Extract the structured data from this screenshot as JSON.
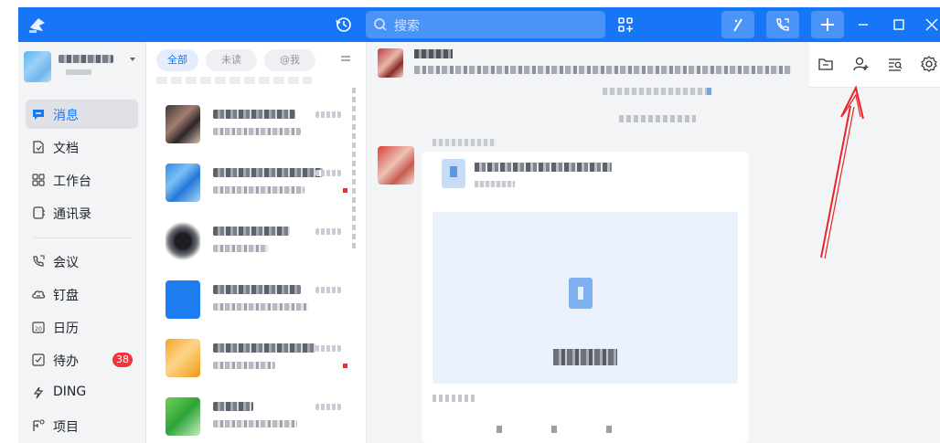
{
  "titlebar": {
    "search_placeholder": "搜索",
    "accent_color": "#1676f5",
    "icons": [
      "logo-icon",
      "history-icon",
      "search-icon",
      "apps-icon",
      "slash-app-icon",
      "phone-icon",
      "plus-icon",
      "minimize-icon",
      "maximize-icon",
      "close-icon"
    ]
  },
  "nav": {
    "items": [
      {
        "label": "消息",
        "icon": "message-icon",
        "active": true
      },
      {
        "label": "文档",
        "icon": "document-icon"
      },
      {
        "label": "工作台",
        "icon": "workbench-icon"
      },
      {
        "label": "通讯录",
        "icon": "contacts-icon"
      },
      {
        "label": "会议",
        "icon": "meeting-icon"
      },
      {
        "label": "钉盘",
        "icon": "cloud-drive-icon"
      },
      {
        "label": "日历",
        "icon": "calendar-icon"
      },
      {
        "label": "待办",
        "icon": "todo-icon",
        "badge": "38"
      },
      {
        "label": "DING",
        "icon": "ding-icon"
      },
      {
        "label": "项目",
        "icon": "project-icon"
      }
    ]
  },
  "convlist": {
    "filters": [
      "全部",
      "未读",
      "@我"
    ]
  },
  "chat": {
    "header_icons": [
      "folder-icon",
      "add-member-icon",
      "search-history-icon",
      "settings-icon"
    ]
  },
  "annotation": {
    "color": "#e8242a"
  }
}
